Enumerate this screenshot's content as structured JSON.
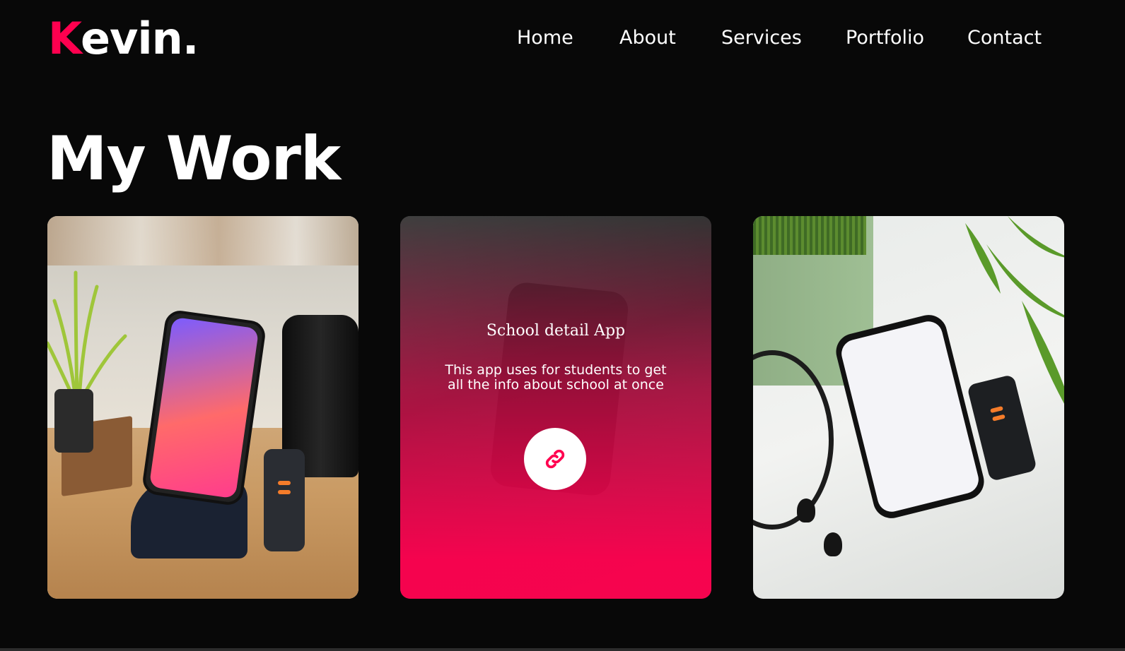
{
  "brand": {
    "logo_initial": "K",
    "logo_rest": "evin.",
    "accent_color": "#ff004f"
  },
  "nav": {
    "items": [
      "Home",
      "About",
      "Services",
      "Portfolio",
      "Contact"
    ]
  },
  "section": {
    "title": "My Work"
  },
  "portfolio": [
    {
      "image": "phone-on-stand-photo"
    },
    {
      "image": "school-app-photo",
      "title": "School detail App",
      "description": "This app uses for students to get all the info about school at once",
      "link_icon": "link-icon"
    },
    {
      "image": "us-store-app-photo"
    }
  ]
}
